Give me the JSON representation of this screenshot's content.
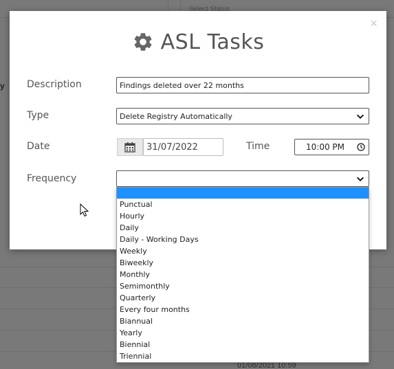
{
  "background": {
    "header_right_text": "Select Status",
    "cut_text_left": "y",
    "cut_text_bottom": "01/08/2021 10:59"
  },
  "modal": {
    "title": "ASL Tasks",
    "title_icon": "gear-icon",
    "close_label": "×",
    "description_label": "Description",
    "description_value": "Findings deleted over 22 months",
    "type_label": "Type",
    "type_value": "Delete Registry Automatically",
    "date_label": "Date",
    "date_value": "31/07/2022",
    "time_label": "Time",
    "time_value": "10:00 PM",
    "frequency_label": "Frequency",
    "frequency_value": ""
  },
  "frequency_options": [
    "",
    "Punctual",
    "Hourly",
    "Daily",
    "Daily - Working Days",
    "Weekly",
    "Biweekly",
    "Monthly",
    "Semimonthly",
    "Quarterly",
    "Every four months",
    "Biannual",
    "Yearly",
    "Biennial",
    "Triennial"
  ],
  "colors": {
    "highlight": "#1e90ff",
    "label_text": "#555555",
    "overlay": "#7d7d7d"
  }
}
